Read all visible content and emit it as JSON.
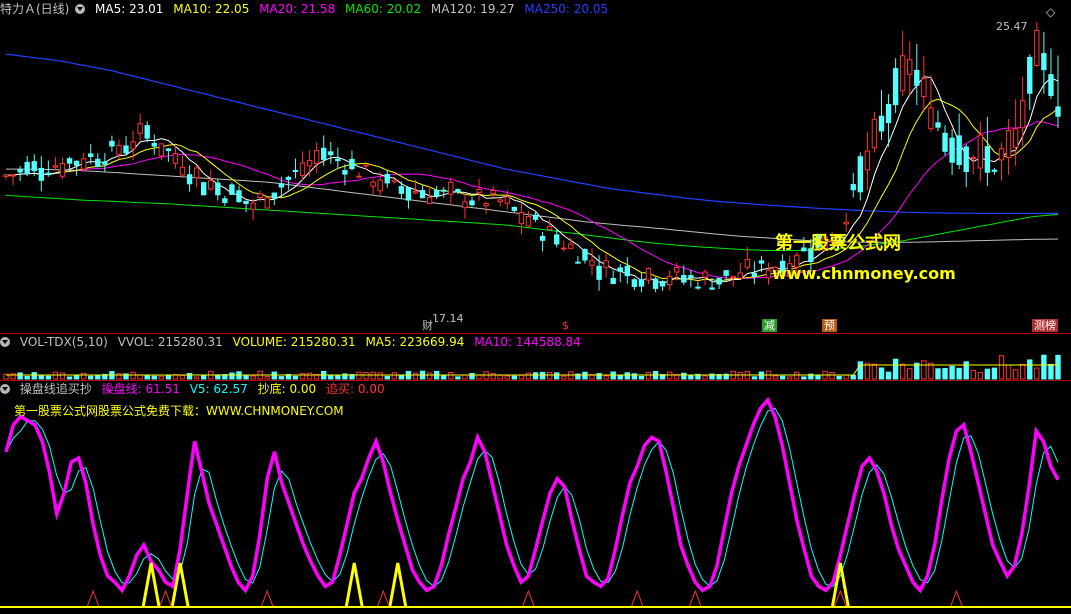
{
  "main_header": {
    "title": "特力Ａ(日线)",
    "ma5": "MA5: 23.01",
    "ma10": "MA10: 22.05",
    "ma20": "MA20: 21.58",
    "ma60": "MA60: 20.02",
    "ma120": "MA120: 19.27",
    "ma250": "MA250: 20.05"
  },
  "vol_header": {
    "name": "VOL-TDX(5,10)",
    "vvol": "VVOL: 215280.31",
    "volume": "VOLUME: 215280.31",
    "ma5": "MA5: 223669.94",
    "ma10": "MA10: 144588.84"
  },
  "ind_header": {
    "name": "操盘线追买抄",
    "cpx": "操盘线: 61.51",
    "v5": "V5: 62.57",
    "chaodi": "抄底: 0.00",
    "zhuimai": "追买: 0.00"
  },
  "watermark": {
    "cn": "第一股票公式网",
    "url": "www.chnmoney.com",
    "note": "第一股票公式网股票公式免费下载：WWW.CHNMONEY.COM"
  },
  "price_labels": {
    "high": "25.47",
    "low": "17.14"
  },
  "markers": [
    {
      "text": "财",
      "color": "#c0c0c0",
      "bg": "#000000"
    },
    {
      "text": "$",
      "color": "#ff3030",
      "bg": "#000000"
    },
    {
      "text": "减",
      "color": "#ffffff",
      "bg": "#2a9a2a"
    },
    {
      "text": "预",
      "color": "#ffffff",
      "bg": "#b85a10"
    },
    {
      "text": "测榜",
      "color": "#ffffff",
      "bg": "#b03030"
    }
  ],
  "colors": {
    "up": "#ff3232",
    "down": "#54ffff",
    "ma5": "#ffffff",
    "ma10": "#ffff00",
    "ma20": "#ff00ff",
    "ma60": "#00e600",
    "ma120": "#c0c0c0",
    "ma250": "#2040ff",
    "cpx": "#ff00ff",
    "v5": "#00ffff",
    "chaodi": "#ffff00",
    "zhuimai": "#ff3232"
  },
  "chart_data": [
    {
      "type": "candlestick",
      "title": "特力Ａ(日线)",
      "ylim": [
        16.5,
        26.0
      ],
      "price_high": 25.47,
      "price_low": 17.14,
      "series": [
        {
          "name": "MA5",
          "values": []
        },
        {
          "name": "MA10",
          "values": []
        },
        {
          "name": "MA20",
          "values": []
        },
        {
          "name": "MA60",
          "values": [
            20.6,
            20.55,
            20.5,
            20.45,
            20.42,
            20.38,
            20.35,
            20.3,
            20.25,
            20.2,
            20.15,
            20.1,
            20.05,
            20.0,
            19.95,
            19.9,
            19.85,
            19.8,
            19.75,
            19.7,
            19.6,
            19.5,
            19.4,
            19.3,
            19.2,
            19.12,
            19.05,
            19.0,
            18.95,
            18.92,
            18.92,
            18.95,
            19.0,
            19.1,
            19.2,
            19.35,
            19.5,
            19.65,
            19.8,
            19.95,
            20.02
          ]
        },
        {
          "name": "MA120",
          "values": [
            21.4,
            21.4,
            21.38,
            21.35,
            21.3,
            21.25,
            21.2,
            21.15,
            21.1,
            21.05,
            21.0,
            20.9,
            20.8,
            20.7,
            20.6,
            20.5,
            20.4,
            20.3,
            20.2,
            20.1,
            20.0,
            19.9,
            19.8,
            19.72,
            19.65,
            19.58,
            19.5,
            19.42,
            19.35,
            19.3,
            19.25,
            19.2,
            19.18,
            19.17,
            19.17,
            19.18,
            19.2,
            19.22,
            19.24,
            19.26,
            19.27
          ]
        },
        {
          "name": "MA250",
          "values": [
            24.9,
            24.8,
            24.7,
            24.55,
            24.4,
            24.2,
            24.0,
            23.8,
            23.6,
            23.4,
            23.2,
            23.0,
            22.8,
            22.6,
            22.4,
            22.2,
            22.0,
            21.8,
            21.6,
            21.4,
            21.25,
            21.1,
            20.95,
            20.8,
            20.7,
            20.6,
            20.5,
            20.42,
            20.36,
            20.3,
            20.25,
            20.2,
            20.16,
            20.12,
            20.09,
            20.07,
            20.06,
            20.05,
            20.05,
            20.05,
            20.05
          ]
        }
      ]
    },
    {
      "type": "bar",
      "title": "VOL-TDX(5,10)",
      "series": [
        {
          "name": "VOLUME",
          "values": []
        }
      ]
    },
    {
      "type": "line",
      "title": "操盘线追买抄",
      "ylim": [
        0,
        100
      ],
      "series": [
        {
          "name": "操盘线",
          "values": [
            75,
            88,
            92,
            90,
            88,
            80,
            65,
            45,
            55,
            70,
            72,
            60,
            40,
            25,
            15,
            12,
            8,
            15,
            25,
            30,
            22,
            18,
            12,
            10,
            28,
            55,
            80,
            65,
            50,
            40,
            30,
            20,
            12,
            8,
            15,
            35,
            62,
            75,
            60,
            50,
            40,
            30,
            22,
            15,
            10,
            12,
            25,
            40,
            55,
            62,
            72,
            80,
            70,
            55,
            42,
            30,
            18,
            12,
            8,
            10,
            20,
            35,
            48,
            62,
            70,
            82,
            75,
            60,
            45,
            30,
            20,
            12,
            15,
            28,
            42,
            55,
            62,
            58,
            42,
            28,
            15,
            12,
            10,
            14,
            28,
            45,
            60,
            68,
            78,
            82,
            80,
            65,
            48,
            30,
            20,
            12,
            8,
            10,
            20,
            38,
            55,
            68,
            78,
            88,
            96,
            100,
            92,
            78,
            60,
            42,
            28,
            15,
            10,
            8,
            12,
            25,
            40,
            55,
            68,
            72,
            66,
            55,
            40,
            28,
            20,
            12,
            8,
            15,
            30,
            52,
            72,
            85,
            88,
            75,
            60,
            45,
            30,
            22,
            15,
            20,
            35,
            58,
            85,
            80,
            68,
            61.51
          ]
        },
        {
          "name": "V5",
          "values": []
        },
        {
          "name": "抄底",
          "values": []
        },
        {
          "name": "追买",
          "values": []
        }
      ]
    }
  ]
}
